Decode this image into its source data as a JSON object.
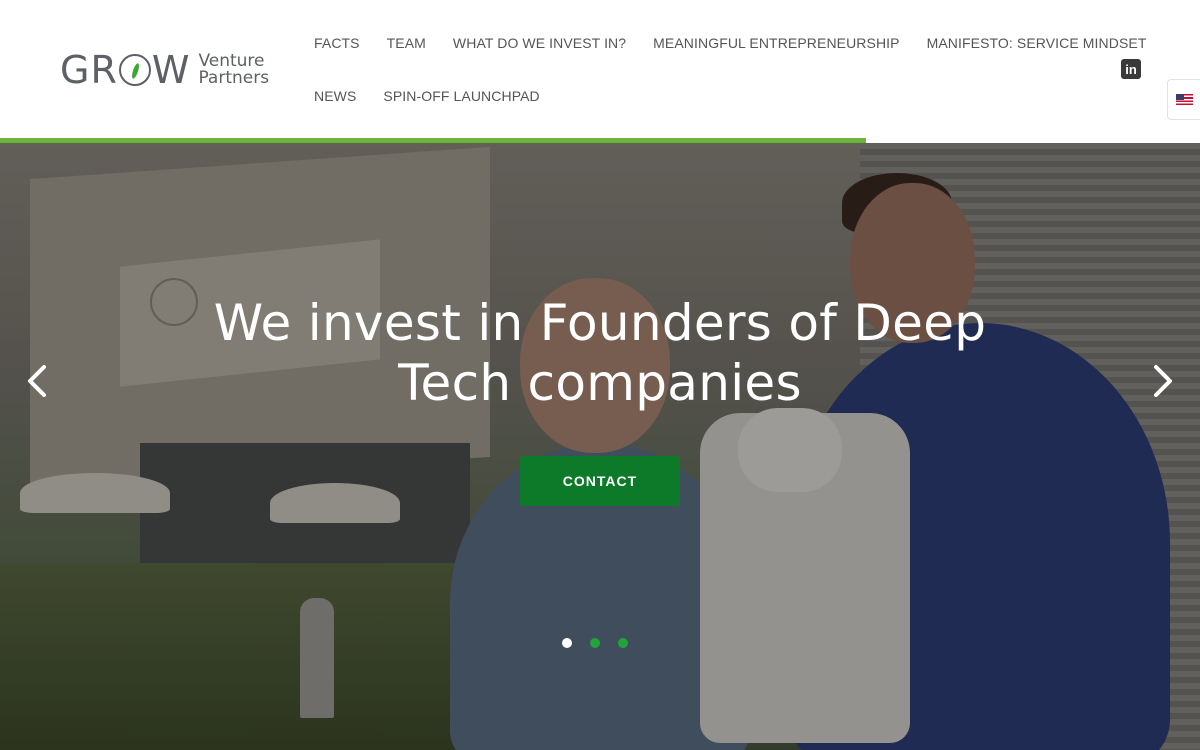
{
  "logo": {
    "word": "GR",
    "word_end": "W",
    "line1": "Venture",
    "line2": "Partners"
  },
  "nav": {
    "row1": [
      "FACTS",
      "TEAM",
      "WHAT DO WE INVEST IN?",
      "MEANINGFUL ENTREPRENEURSHIP",
      "MANIFESTO: SERVICE MINDSET"
    ],
    "row2": [
      "NEWS",
      "SPIN-OFF LAUNCHPAD"
    ]
  },
  "social": {
    "linkedin_label": "in",
    "icon": "linkedin-icon"
  },
  "language": {
    "icon": "us-flag-icon"
  },
  "slider": {
    "progress": 0.722,
    "title_line1": "We invest in Founders of Deep",
    "title_line2": "Tech companies",
    "cta_label": "CONTACT",
    "slide_count": 3,
    "active_slide": 1
  },
  "colors": {
    "accent_green": "#6ab53a",
    "button_green": "#0d7a2a",
    "dot_active": "#ffffff",
    "dot_inactive": "#1fa53a",
    "nav_text": "#555555"
  }
}
